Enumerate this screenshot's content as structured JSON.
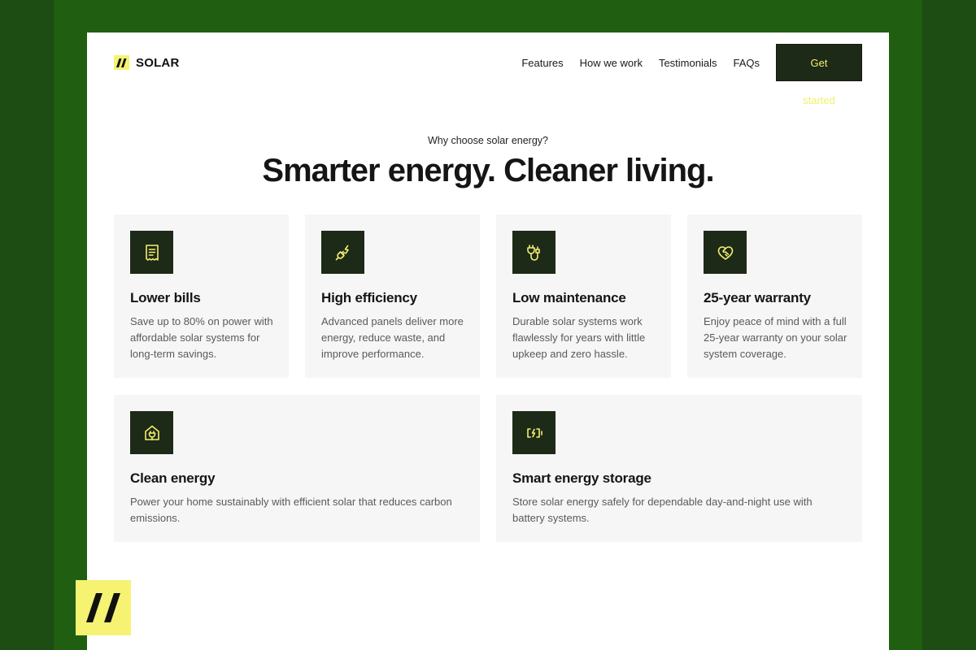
{
  "brand": {
    "name": "SOLAR",
    "accent_color": "#f5f371",
    "dark_color": "#1d2a18",
    "background_color": "#205f11"
  },
  "nav": {
    "links": [
      "Features",
      "How we work",
      "Testimonials",
      "FAQs"
    ],
    "cta_label": "Get started"
  },
  "hero": {
    "eyebrow": "Why choose solar energy?",
    "title": "Smarter energy. Cleaner living."
  },
  "features": [
    {
      "icon": "receipt-icon",
      "title": "Lower bills",
      "description": "Save up to 80% on power with affordable solar systems for long-term savings."
    },
    {
      "icon": "plug-bolt-icon",
      "title": "High efficiency",
      "description": "Advanced panels deliver more energy, reduce waste, and improve performance."
    },
    {
      "icon": "plug-cable-icon",
      "title": "Low maintenance",
      "description": "Durable solar systems work flawlessly for years with little upkeep and zero hassle."
    },
    {
      "icon": "heart-handshake-icon",
      "title": "25-year warranty",
      "description": "Enjoy peace of mind with a full 25-year warranty on your solar system coverage."
    },
    {
      "icon": "home-plug-icon",
      "title": "Clean energy",
      "description": "Power your home sustainably with efficient solar that reduces carbon emissions."
    },
    {
      "icon": "battery-charging-icon",
      "title": "Smart energy storage",
      "description": "Store solar energy safely for dependable day-and-night use with battery systems."
    }
  ]
}
